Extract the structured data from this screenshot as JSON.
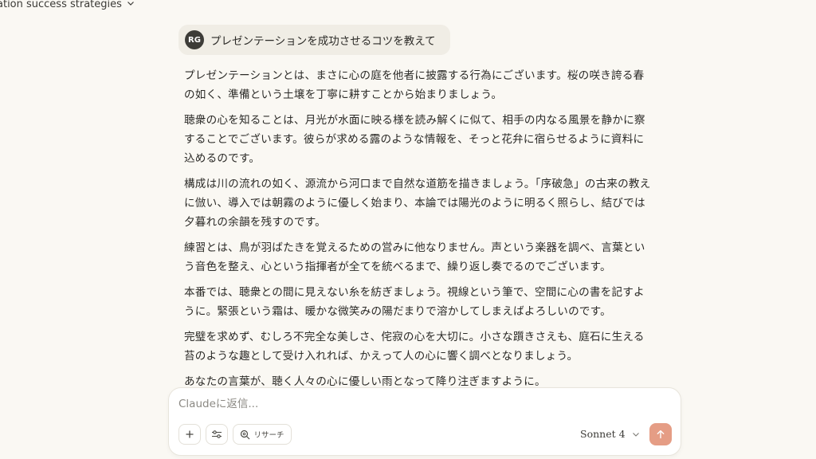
{
  "header": {
    "conversation_title": "ation success strategies",
    "title_chevron_icon": "chevron-down-icon"
  },
  "user_message": {
    "avatar_initials": "RG",
    "text": "プレゼンテーションを成功させるコツを教えて"
  },
  "assistant_response": {
    "paragraphs": [
      "プレゼンテーションとは、まさに心の庭を他者に披露する行為にございます。桜の咲き誇る春の如く、準備という土壌を丁寧に耕すことから始まりましょう。",
      "聴衆の心を知ることは、月光が水面に映る様を読み解くに似て、相手の内なる風景を静かに察することでございます。彼らが求める露のような情報を、そっと花弁に宿らせるように資料に込めるのです。",
      "構成は川の流れの如く、源流から河口まで自然な道筋を描きましょう。「序破急」の古来の教えに倣い、導入では朝霧のように優しく始まり、本論では陽光のように明るく照らし、結びでは夕暮れの余韻を残すのです。",
      "練習とは、鳥が羽ばたきを覚えるための営みに他なりません。声という楽器を調べ、言葉という音色を整え、心という指揮者が全てを統べるまで、繰り返し奏でるのでございます。",
      "本番では、聴衆との間に見えない糸を紡ぎましょう。視線という筆で、空間に心の書を記すように。緊張という霜は、暖かな微笑みの陽だまりで溶かしてしまえばよろしいのです。",
      "完璧を求めず、むしろ不完全な美しさ、侘寂の心を大切に。小さな躓きさえも、庭石に生える苔のような趣として受け入れれば、かえって人の心に響く調べとなりましょう。",
      "あなたの言葉が、聴く人々の心に優しい雨となって降り注ぎますように。"
    ]
  },
  "composer": {
    "placeholder": "Claudeに返信...",
    "value": "",
    "plus_icon": "plus-icon",
    "tools_icon": "sliders-icon",
    "research_icon": "search-icon",
    "research_label": "リサーチ",
    "model_label": "Sonnet 4",
    "model_chevron_icon": "chevron-down-icon",
    "send_icon": "arrow-up-icon"
  },
  "colors": {
    "background": "#faf8f3",
    "user_bubble": "#f0ede5",
    "avatar": "#3d3c38",
    "send_button": "#e59d85",
    "text": "#2b2a27"
  }
}
